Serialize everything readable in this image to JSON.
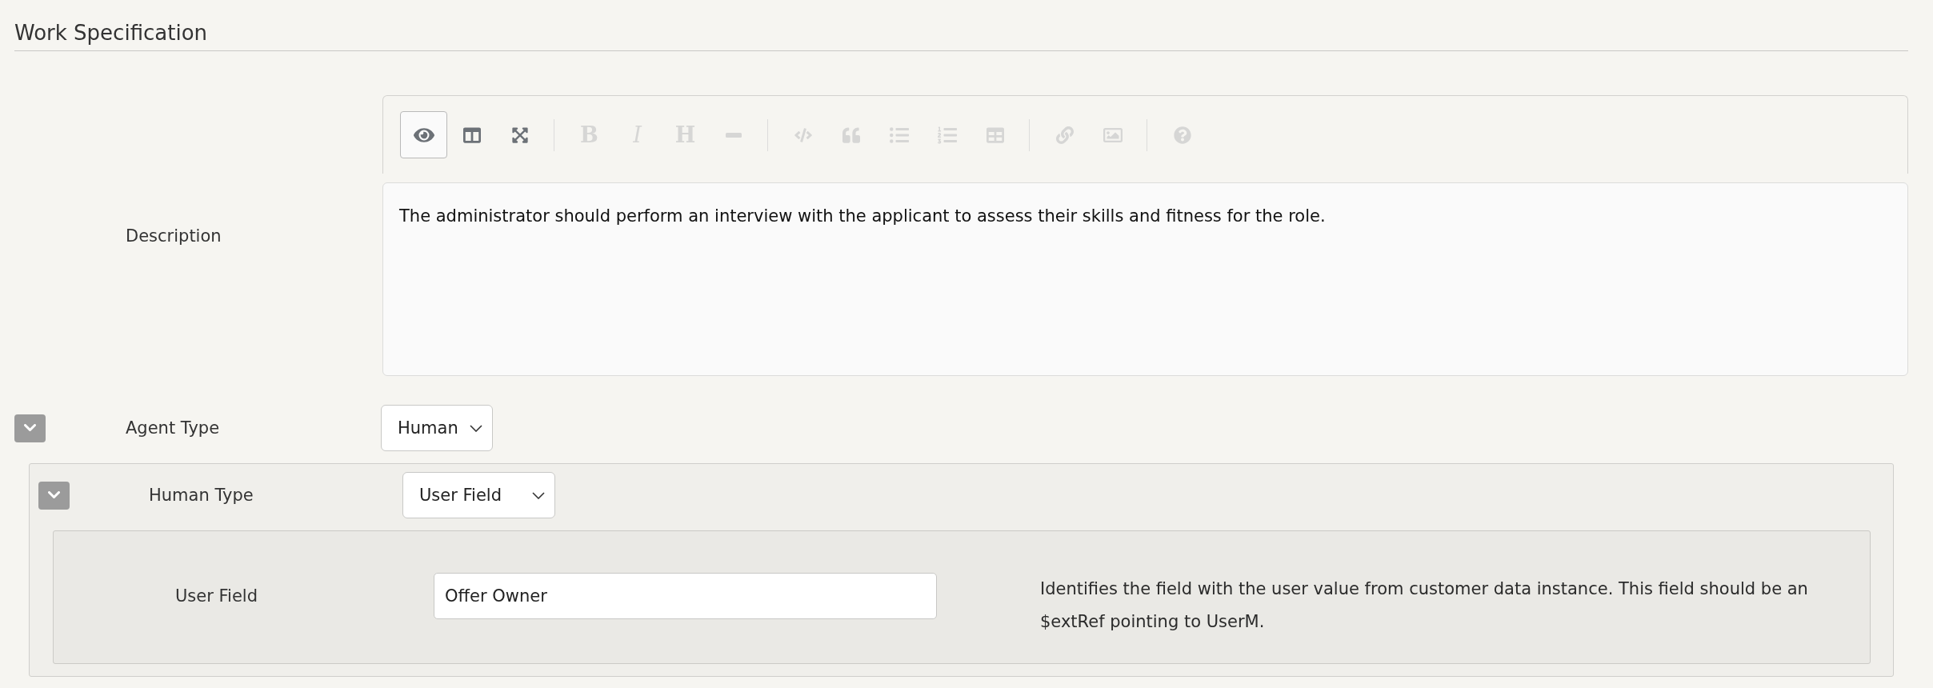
{
  "section": {
    "title": "Work Specification"
  },
  "description": {
    "label": "Description",
    "toolbar": [
      [
        {
          "active": true,
          "disabled": false
        },
        {
          "active": false,
          "disabled": false
        },
        {
          "active": false,
          "disabled": false
        }
      ],
      [
        {
          "label": "B",
          "active": false,
          "disabled": true
        },
        {
          "label": "I",
          "active": false,
          "disabled": true
        },
        {
          "label": "H",
          "active": false,
          "disabled": true
        },
        {
          "active": false,
          "disabled": true
        }
      ],
      [
        {
          "active": false,
          "disabled": true
        },
        {
          "active": false,
          "disabled": true
        },
        {
          "active": false,
          "disabled": true
        },
        {
          "active": false,
          "disabled": true
        },
        {
          "active": false,
          "disabled": true
        }
      ],
      [
        {
          "active": false,
          "disabled": true
        },
        {
          "active": false,
          "disabled": true
        }
      ],
      [
        {
          "active": false,
          "disabled": true
        }
      ]
    ],
    "text": "The administrator should perform an interview with the applicant to assess their skills and fitness for the role."
  },
  "agent_type": {
    "label": "Agent Type",
    "expanded": true,
    "value": "Human",
    "human_type": {
      "label": "Human Type",
      "expanded": true,
      "value": "User Field",
      "user_field": {
        "label": "User Field",
        "value": "Offer Owner",
        "help": "Identifies the field with the user value from customer data instance. This field should be an $extRef pointing to UserM."
      }
    }
  }
}
